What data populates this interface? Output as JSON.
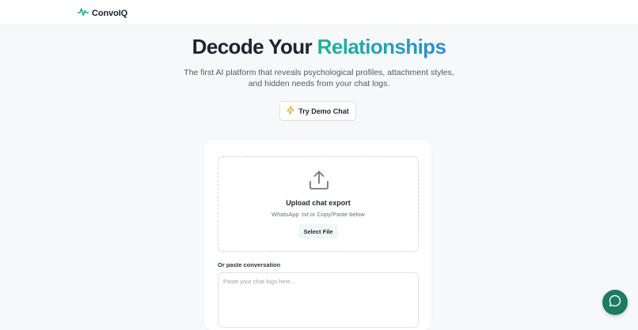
{
  "brand": {
    "name": "ConvoIQ",
    "icon": "pulse-icon"
  },
  "hero": {
    "title_main": "Decode Your",
    "title_accent": "Relationships",
    "subtitle": "The first AI platform that reveals psychological profiles, attachment styles, and hidden needs from your chat logs."
  },
  "demo_button": {
    "label": "Try Demo Chat",
    "icon": "lightning-icon"
  },
  "upload": {
    "icon": "upload-icon",
    "title": "Upload chat export",
    "subtitle": "WhatsApp .txt or Copy/Paste below",
    "select_file_label": "Select File"
  },
  "paste": {
    "label": "Or paste conversation",
    "placeholder": "Paste your chat logs here..."
  },
  "chat_fab": {
    "icon": "chat-bubble-icon"
  },
  "colors": {
    "accent_start": "#20b39a",
    "accent_end": "#2f8fc8",
    "fab": "#1d7a63",
    "brand_icon": "#1fa98e"
  }
}
